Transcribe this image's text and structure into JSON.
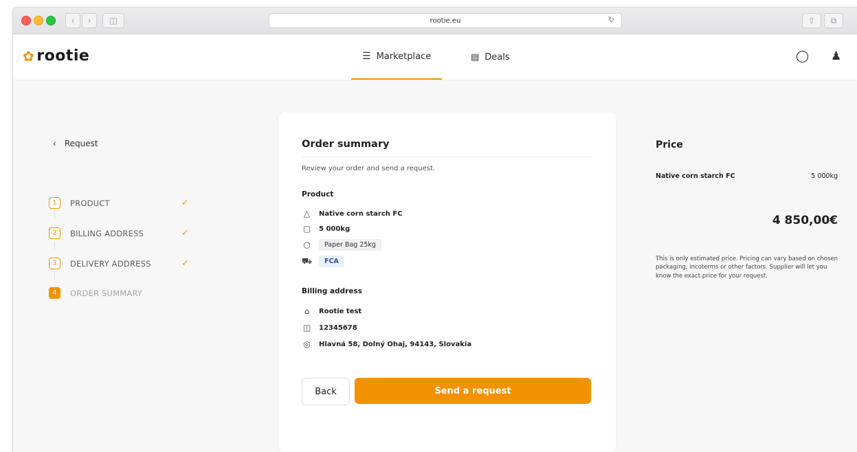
{
  "browser": {
    "url": "rootie.eu",
    "back_icon": "chevron-left-icon",
    "forward_icon": "chevron-right-icon",
    "sidebar_icon": "sidebar-icon",
    "reload_icon": "reload-icon",
    "share_icon": "share-icon",
    "tabs_icon": "tabs-icon"
  },
  "header": {
    "logo_text": "rootie",
    "nav": [
      {
        "label": "Marketplace",
        "icon": "layers-icon",
        "active": true
      },
      {
        "label": "Deals",
        "icon": "document-icon",
        "active": false
      }
    ],
    "chat_icon": "chat-icon",
    "user_icon": "user-icon"
  },
  "sidebar": {
    "back_label": "Request",
    "steps": [
      {
        "number": "1",
        "label": "PRODUCT",
        "done": true
      },
      {
        "number": "2",
        "label": "BILLING ADDRESS",
        "done": true
      },
      {
        "number": "3",
        "label": "DELIVERY ADDRESS",
        "done": true
      },
      {
        "number": "4",
        "label": "ORDER SUMMARY",
        "done": false
      }
    ]
  },
  "summary": {
    "title": "Order summary",
    "subtitle": "Review your order and send a request.",
    "product_heading": "Product",
    "product_name": "Native corn starch FC",
    "quantity": "5 000kg",
    "packaging": "Paper Bag 25kg",
    "incoterm": "FCA",
    "billing_heading": "Billing address",
    "company": "Rootie test",
    "id_number": "12345678",
    "address": "Hlavná 58, Dolný Ohaj, 94143, Slovakia",
    "back_button": "Back",
    "send_button": "Send a request"
  },
  "price": {
    "title": "Price",
    "product_name": "Native corn starch FC",
    "quantity": "5 000kg",
    "total": "4 850,00€",
    "note": "This is only estimated price. Pricing can vary based on chosen packaging, incoterms or other factors. Supplier will let you know the exact price for your request."
  },
  "colors": {
    "accent": "#f39200",
    "incoterm_pill_bg": "#e8f0fb"
  }
}
